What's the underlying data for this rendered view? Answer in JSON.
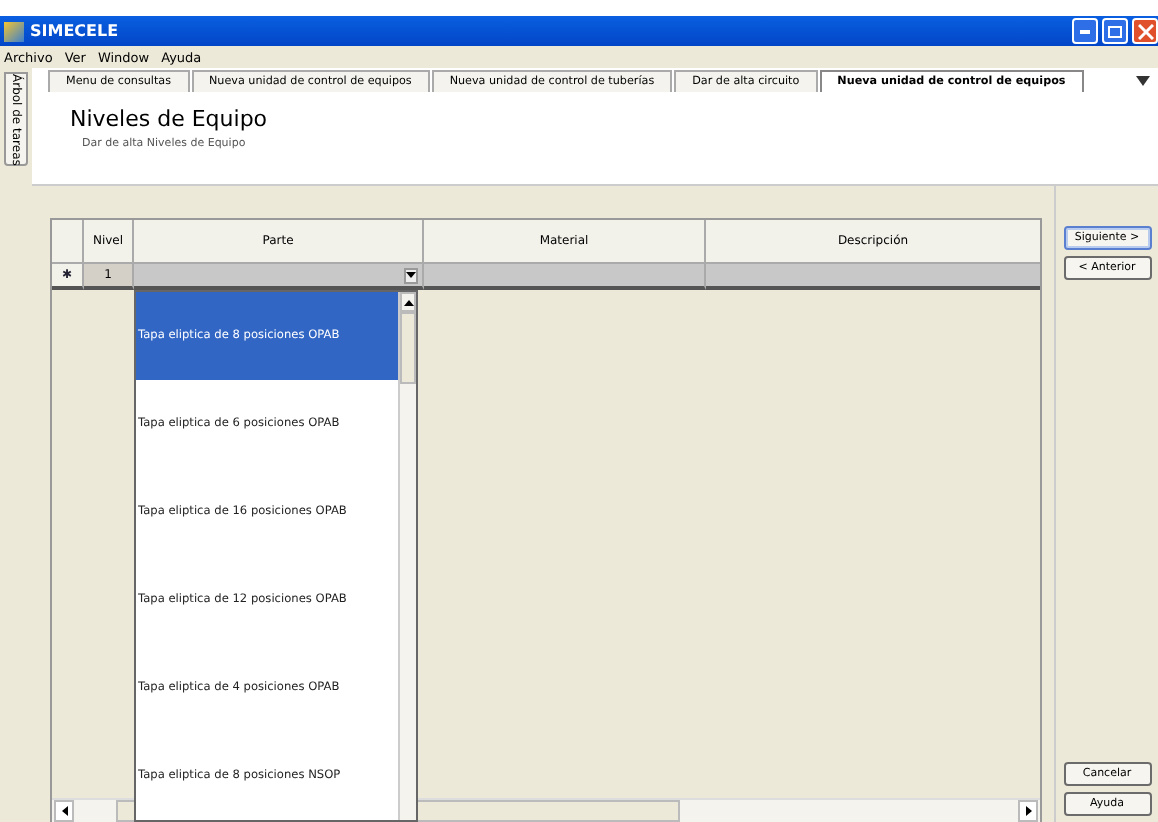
{
  "window": {
    "title": "SIMECELE"
  },
  "menu": [
    "Archivo",
    "Ver",
    "Window",
    "Ayuda"
  ],
  "side_tab": "Árbol de tareas",
  "tabs": [
    {
      "label": "Menu de consultas",
      "selected": false
    },
    {
      "label": "Nueva unidad de control de equipos",
      "selected": false
    },
    {
      "label": "Nueva unidad de control de tuberías",
      "selected": false
    },
    {
      "label": "Dar de alta circuito",
      "selected": false
    },
    {
      "label": "Nueva unidad de control de equipos",
      "selected": true
    }
  ],
  "header": {
    "title": "Niveles de Equipo",
    "subtitle": "Dar de alta Niveles de Equipo"
  },
  "table": {
    "columns": [
      "Nivel",
      "Parte",
      "Material",
      "Descripción"
    ],
    "rows": [
      {
        "marker": "✱",
        "cells": [
          "1",
          "",
          "",
          ""
        ]
      }
    ]
  },
  "dropdown": {
    "items": [
      {
        "label": "Tapa eliptica de 8 posiciones OPAB",
        "selected": true
      },
      {
        "label": "Tapa eliptica de 6 posiciones OPAB",
        "selected": false
      },
      {
        "label": "Tapa eliptica de 16 posiciones OPAB",
        "selected": false
      },
      {
        "label": "Tapa eliptica de 12 posiciones OPAB",
        "selected": false
      },
      {
        "label": "Tapa eliptica de 4 posiciones OPAB",
        "selected": false
      },
      {
        "label": "Tapa eliptica de 8 posiciones NSOP",
        "selected": false
      }
    ]
  },
  "buttons_top": [
    "Siguiente >",
    "< Anterior"
  ],
  "buttons_bottom": [
    "Cancelar",
    "Ayuda"
  ]
}
